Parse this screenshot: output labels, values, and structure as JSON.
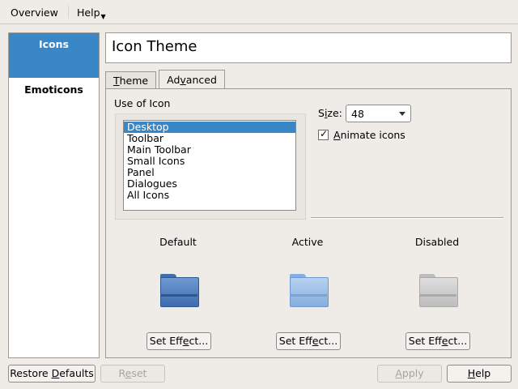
{
  "menubar": {
    "overview": "Overview",
    "help": "Help"
  },
  "sidebar": {
    "items": [
      {
        "label": "Icons",
        "selected": true
      },
      {
        "label": "Emoticons",
        "selected": false
      }
    ]
  },
  "header": {
    "title": "Icon Theme"
  },
  "tabs": [
    {
      "label_pre": "",
      "label_key": "T",
      "label_post": "heme"
    },
    {
      "label_pre": "Ad",
      "label_key": "v",
      "label_post": "anced"
    }
  ],
  "advanced": {
    "use_of_icon_label": "Use of Icon",
    "list_items": [
      "Desktop",
      "Toolbar",
      "Main Toolbar",
      "Small Icons",
      "Panel",
      "Dialogues",
      "All Icons"
    ],
    "selected_item": "Desktop",
    "size_label_pre": "S",
    "size_label_key": "i",
    "size_label_post": "ze:",
    "size_value": "48",
    "animate_key": "A",
    "animate_rest": "nimate icons",
    "animate_checked": true,
    "states": [
      {
        "label": "Default"
      },
      {
        "label": "Active"
      },
      {
        "label": "Disabled"
      }
    ],
    "effect_pre": "Set Eff",
    "effect_key": "e",
    "effect_post": "ct..."
  },
  "footer": {
    "restore_pre": "Restore ",
    "restore_key": "D",
    "restore_post": "efaults",
    "reset_pre": "R",
    "reset_key": "e",
    "reset_post": "set",
    "apply_pre": "",
    "apply_key": "A",
    "apply_post": "pply",
    "help_pre": "",
    "help_key": "H",
    "help_post": "elp"
  },
  "colors": {
    "selection": "#3a87c8",
    "folder_default": "#4f7fbf",
    "folder_active": "#8fb6e6",
    "folder_disabled": "#c4c4c4"
  }
}
